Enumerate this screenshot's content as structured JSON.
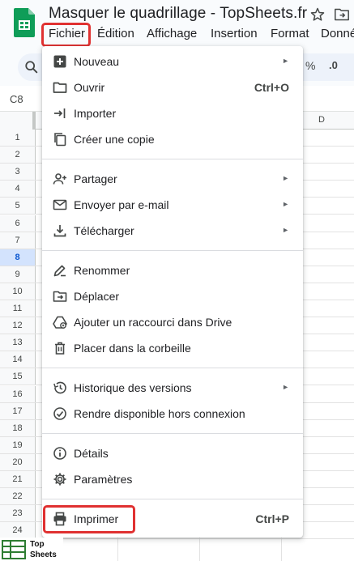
{
  "document": {
    "title": "Masquer le quadrillage - TopSheets.fr"
  },
  "menubar": {
    "items": [
      "Fichier",
      "Édition",
      "Affichage",
      "Insertion",
      "Format",
      "Donné"
    ]
  },
  "toolbar": {
    "percent_label": "%",
    "decimal_label": ".0"
  },
  "formula_bar": {
    "cell_ref": "C8"
  },
  "grid": {
    "visible_column": "D",
    "rows": [
      "1",
      "2",
      "3",
      "4",
      "5",
      "6",
      "7",
      "8",
      "9",
      "10",
      "11",
      "12",
      "13",
      "14",
      "15",
      "16",
      "17",
      "18",
      "19",
      "20",
      "21",
      "22",
      "23",
      "24"
    ],
    "selected_row": "8"
  },
  "file_menu": {
    "items": [
      {
        "label": "Nouveau",
        "icon": "plus-square-icon",
        "submenu": true
      },
      {
        "label": "Ouvrir",
        "icon": "folder-icon",
        "shortcut": "Ctrl+O"
      },
      {
        "label": "Importer",
        "icon": "import-icon"
      },
      {
        "label": "Créer une copie",
        "icon": "copy-icon"
      },
      {
        "label": "Partager",
        "icon": "person-add-icon",
        "submenu": true
      },
      {
        "label": "Envoyer par e-mail",
        "icon": "mail-icon",
        "submenu": true
      },
      {
        "label": "Télécharger",
        "icon": "download-icon",
        "submenu": true
      },
      {
        "label": "Renommer",
        "icon": "rename-icon"
      },
      {
        "label": "Déplacer",
        "icon": "move-folder-icon"
      },
      {
        "label": "Ajouter un raccourci dans Drive",
        "icon": "drive-shortcut-icon"
      },
      {
        "label": "Placer dans la corbeille",
        "icon": "trash-icon"
      },
      {
        "label": "Historique des versions",
        "icon": "history-icon",
        "submenu": true
      },
      {
        "label": "Rendre disponible hors connexion",
        "icon": "offline-check-icon"
      },
      {
        "label": "Détails",
        "icon": "info-icon"
      },
      {
        "label": "Paramètres",
        "icon": "gear-icon"
      },
      {
        "label": "Imprimer",
        "icon": "print-icon",
        "shortcut": "Ctrl+P"
      }
    ],
    "submenu_arrow": "►"
  },
  "watermark": {
    "line1": "Top",
    "line2": "Sheets"
  },
  "colors": {
    "highlight": "#e03131",
    "sheets_green": "#0f9d58",
    "selected_row": "#d3e3fd"
  }
}
